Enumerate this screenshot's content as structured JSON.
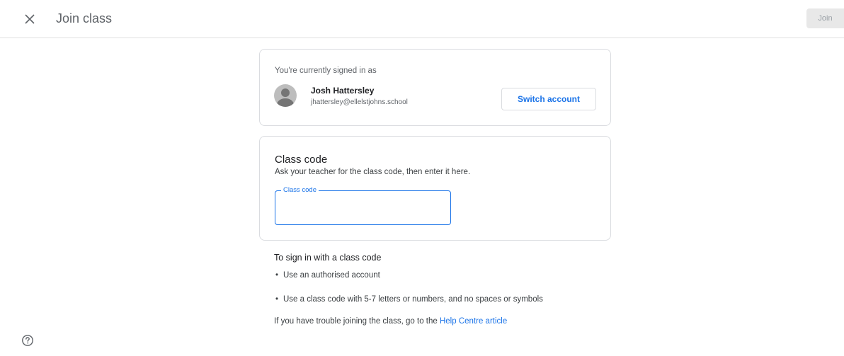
{
  "header": {
    "title": "Join class",
    "join_label": "Join"
  },
  "account": {
    "signed_in_label": "You're currently signed in as",
    "name": "Josh Hattersley",
    "email": "jhattersley@ellelstjohns.school",
    "switch_label": "Switch account"
  },
  "class_code": {
    "title": "Class code",
    "description": "Ask your teacher for the class code, then enter it here.",
    "field_label": "Class code",
    "value": ""
  },
  "help": {
    "title": "To sign in with a class code",
    "items": [
      "Use an authorised account",
      "Use a class code with 5-7 letters or numbers, and no spaces or symbols"
    ],
    "trouble_text": "If you have trouble joining the class, go to the ",
    "link_label": "Help Centre article"
  },
  "icons": {
    "close": "close-icon",
    "help": "help-circle-icon",
    "avatar": "person-avatar-icon"
  },
  "colors": {
    "accent": "#1a73e8",
    "border": "#dadce0",
    "disabled_button": "#e8e8e8"
  }
}
